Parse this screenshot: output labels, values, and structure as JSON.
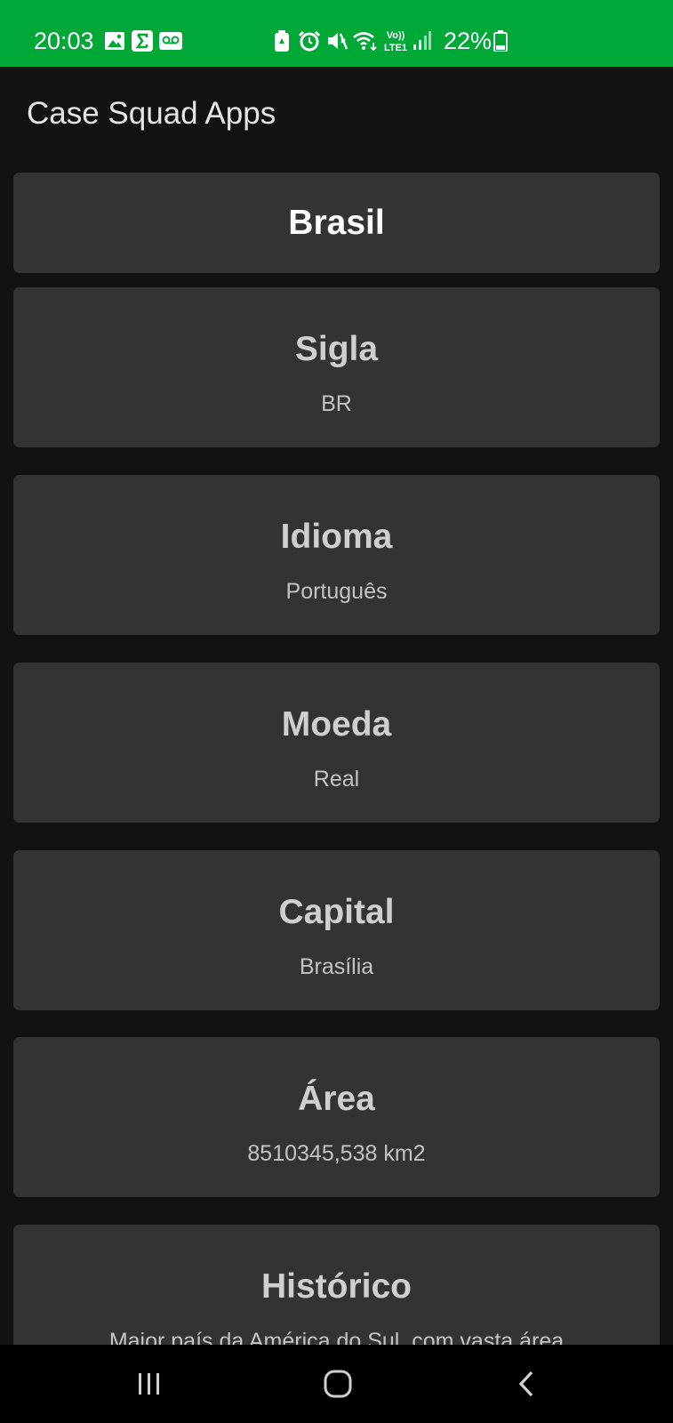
{
  "status_bar": {
    "time": "20:03",
    "battery": "22%",
    "background_color": "#00a838",
    "left_icons": [
      "image-icon",
      "sigma-icon",
      "voicemail-icon"
    ],
    "right_icons": [
      "battery-saver-icon",
      "alarm-icon",
      "mute-icon",
      "wifi-icon",
      "volte-icon",
      "signal-icon",
      "battery-icon"
    ],
    "volte_label_top": "Vo))",
    "volte_label_bottom": "LTE1"
  },
  "app_bar": {
    "title": "Case Squad Apps"
  },
  "country": {
    "name": "Brasil"
  },
  "cards": [
    {
      "label": "Sigla",
      "value": "BR"
    },
    {
      "label": "Idioma",
      "value": "Português"
    },
    {
      "label": "Moeda",
      "value": "Real"
    },
    {
      "label": "Capital",
      "value": "Brasília"
    },
    {
      "label": "Área",
      "value": "8510345,538 km2"
    },
    {
      "label": "Histórico",
      "value": "Maior país da América do Sul, com vasta área"
    }
  ],
  "nav_bar": {
    "icons": [
      "recent-apps-icon",
      "home-icon",
      "back-icon"
    ]
  },
  "colors": {
    "background": "#121212",
    "card": "#333333",
    "status_bar": "#00a838"
  }
}
